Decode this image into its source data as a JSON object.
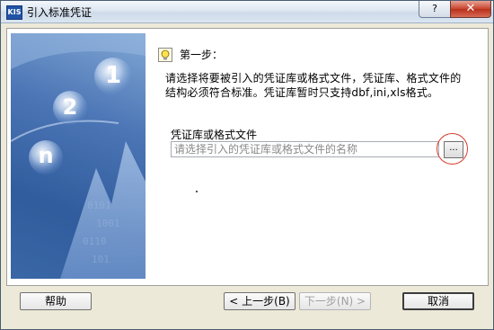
{
  "window": {
    "title": "引入标准凭证",
    "app_icon_label": "KIS",
    "help_button_label": "?",
    "close_button_label": "✕"
  },
  "step": {
    "title": "第一步：",
    "description": "请选择将要被引入的凭证库或格式文件，凭证库、格式文件的结构必须符合标准。凭证库暂时只支持dbf,ini,xls格式。"
  },
  "file_field": {
    "label": "凭证库或格式文件",
    "placeholder": "请选择引入的凭证库或格式文件的名称",
    "value": "",
    "browse_label": "..."
  },
  "footer": {
    "help_label": "帮助",
    "prev_label": "< 上一步(B)",
    "next_label": "下一步(N) >",
    "cancel_label": "取消"
  },
  "side_image": {
    "digits": [
      "1",
      "2",
      "n"
    ],
    "background_digits": "01011010 0110 1001 10"
  },
  "colors": {
    "annotation_circle": "#d83a2a",
    "side_image_primary": "#3f6aa9"
  }
}
